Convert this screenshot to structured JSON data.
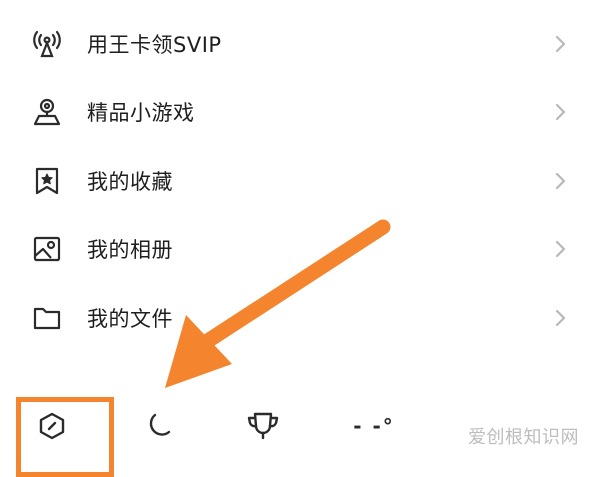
{
  "menu": {
    "items": [
      {
        "label": "用王卡领SVIP",
        "icon": "antenna-icon"
      },
      {
        "label": "精品小游戏",
        "icon": "location-pin-icon"
      },
      {
        "label": "我的收藏",
        "icon": "bookmark-star-icon"
      },
      {
        "label": "我的相册",
        "icon": "photo-album-icon"
      },
      {
        "label": "我的文件",
        "icon": "folder-icon"
      }
    ]
  },
  "toolbar": {
    "tools": [
      {
        "icon": "hexagon-icon"
      },
      {
        "icon": "moon-icon"
      },
      {
        "icon": "trophy-icon"
      },
      {
        "label": "- -°",
        "icon": "temperature-icon"
      }
    ]
  },
  "watermark": "爱创根知识网",
  "colors": {
    "accent": "#f4852e",
    "text": "#1e1e1e",
    "icon": "#2b2b2b",
    "chevron": "#b8b8b8"
  }
}
